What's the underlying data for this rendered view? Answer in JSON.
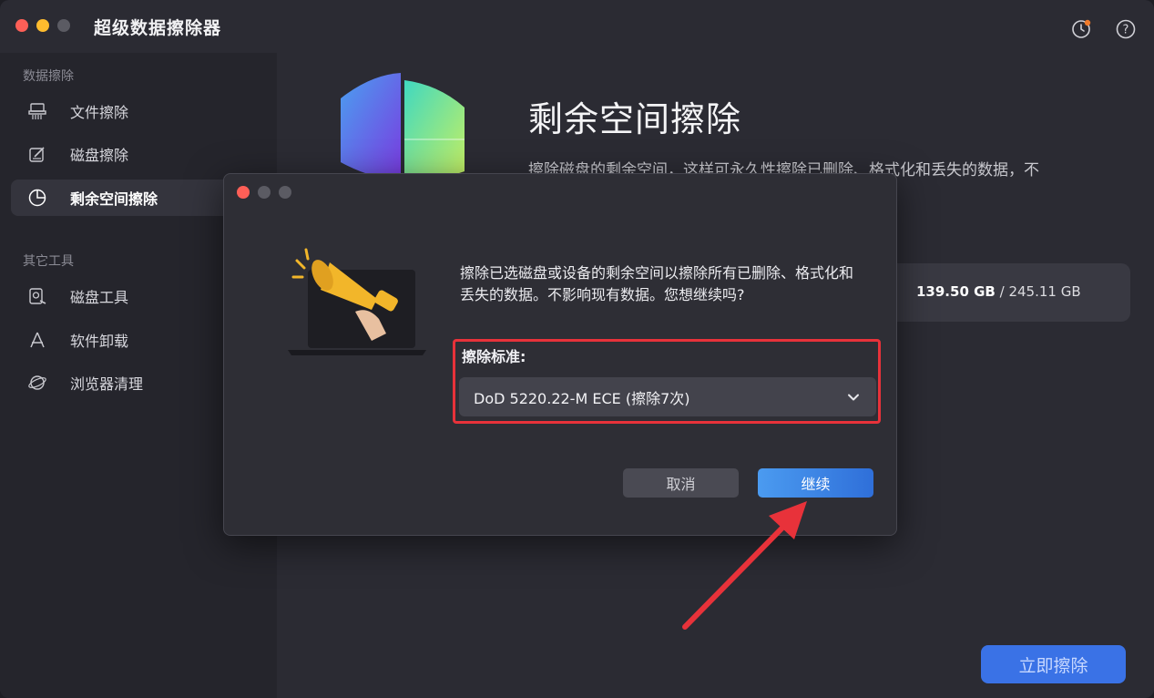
{
  "app": {
    "title": "超级数据擦除器"
  },
  "titlebar": {
    "icons": [
      "history-icon",
      "help-icon"
    ]
  },
  "sidebar": {
    "section1_label": "数据擦除",
    "section2_label": "其它工具",
    "items": [
      {
        "label": "文件擦除",
        "icon": "shredder-icon",
        "active": false
      },
      {
        "label": "磁盘擦除",
        "icon": "disk-edit-icon",
        "active": false
      },
      {
        "label": "剩余空间擦除",
        "icon": "pie-chart-icon",
        "active": true
      },
      {
        "label": "磁盘工具",
        "icon": "disk-tool-icon",
        "active": false
      },
      {
        "label": "软件卸载",
        "icon": "app-uninstall-icon",
        "active": false
      },
      {
        "label": "浏览器清理",
        "icon": "browser-icon",
        "active": false
      }
    ]
  },
  "main": {
    "title": "剩余空间擦除",
    "description": "擦除磁盘的剩余空间，这样可永久性擦除已删除、格式化和丢失的数据，不",
    "disk_used": "139.50 GB",
    "disk_total": " / 245.11 GB",
    "erase_button": "立即擦除"
  },
  "dialog": {
    "message": "擦除已选磁盘或设备的剩余空间以擦除所有已删除、格式化和丢失的数据。不影响现有数据。您想继续吗?",
    "standard_label": "擦除标准:",
    "standard_value": "DoD 5220.22-M ECE (擦除7次)",
    "cancel_label": "取消",
    "continue_label": "继续"
  },
  "colors": {
    "accent": "#3a72e6",
    "highlight": "#e8323a",
    "background": "#2b2b33"
  }
}
